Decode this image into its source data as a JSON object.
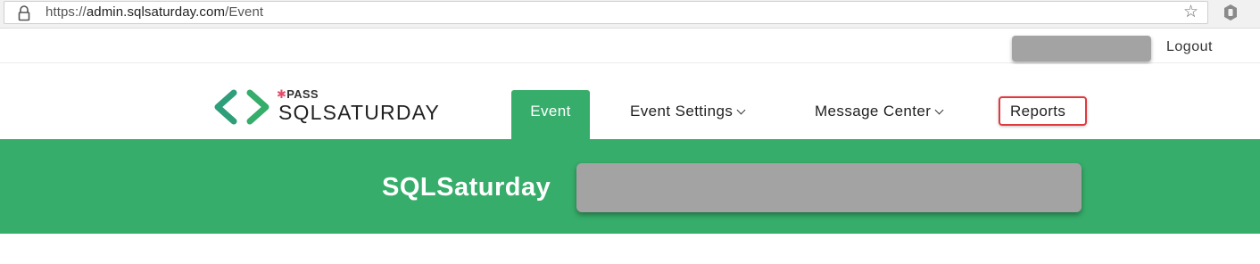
{
  "browser": {
    "url_scheme": "https://",
    "url_host": "admin.sqlsaturday.com",
    "url_path": "/Event",
    "icons": [
      "lock-icon",
      "star-icon",
      "extension-icon"
    ]
  },
  "userbar": {
    "logout_label": "Logout"
  },
  "logo": {
    "pass_text": "PASS",
    "name_text": "SQLSATURDAY"
  },
  "nav": {
    "event_label": "Event",
    "event_settings_label": "Event Settings",
    "message_center_label": "Message Center",
    "reports_label": "Reports"
  },
  "banner": {
    "title": "SQLSaturday"
  },
  "colors": {
    "brand_green": "#36ad6a",
    "highlight_red": "#e0393e",
    "redaction_gray": "#a3a3a3"
  }
}
